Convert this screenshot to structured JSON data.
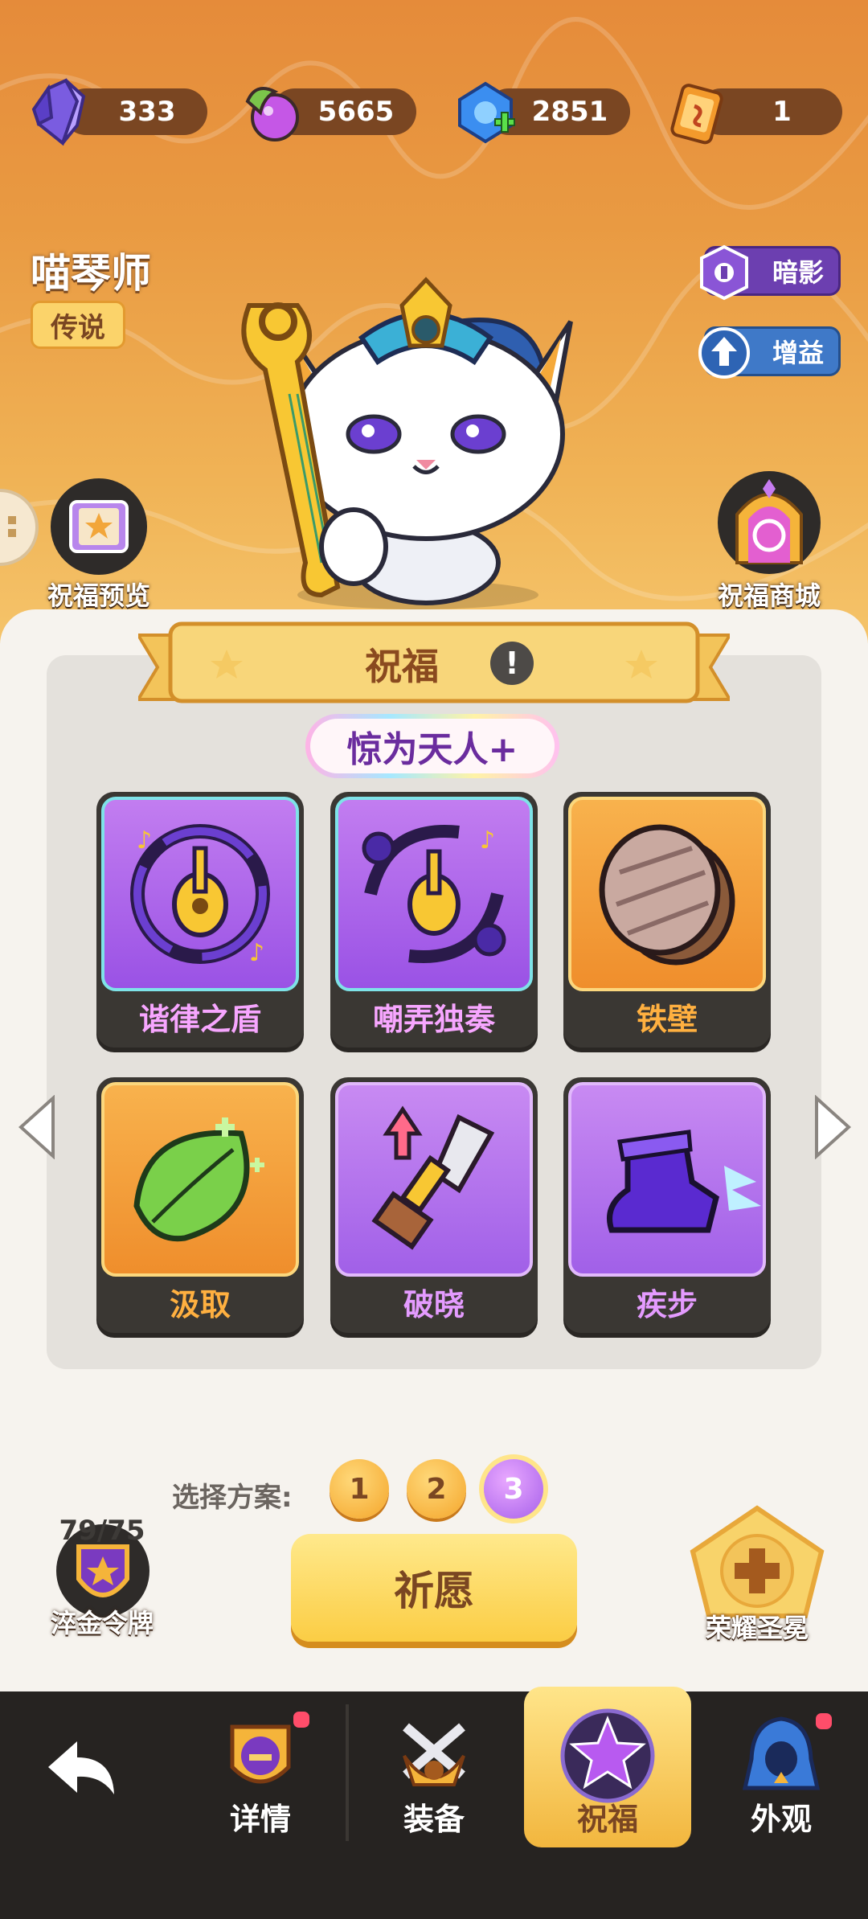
{
  "currency": [
    {
      "icon": "crystal-icon",
      "value": "333"
    },
    {
      "icon": "orb-icon",
      "value": "5665"
    },
    {
      "icon": "gem-plus-icon",
      "value": "2851"
    },
    {
      "icon": "ticket-icon",
      "value": "1"
    }
  ],
  "hero": {
    "name": "喵琴师",
    "rarity": "传说"
  },
  "side_buttons": {
    "shadow": "暗影",
    "buff": "增益"
  },
  "preview_label": "祝福预览",
  "shop_label": "祝福商城",
  "panel": {
    "title": "祝福",
    "info_mark": "!",
    "set_name": "惊为天人+",
    "blessings": [
      {
        "name": "谐律之盾",
        "style": "purple"
      },
      {
        "name": "嘲弄独奏",
        "style": "purple"
      },
      {
        "name": "铁壁",
        "style": "orange"
      },
      {
        "name": "汲取",
        "style": "orange"
      },
      {
        "name": "破晓",
        "style": "violet"
      },
      {
        "name": "疾步",
        "style": "violet"
      }
    ]
  },
  "plan": {
    "label": "选择方案:",
    "options": [
      "1",
      "2",
      "3"
    ],
    "selected": "3"
  },
  "pray_label": "祈愿",
  "token": {
    "count": "79/75",
    "label": "淬金令牌"
  },
  "crown_label": "荣耀圣冕",
  "nav": {
    "back": "back-icon",
    "items": [
      {
        "label": "详情",
        "badge": true
      },
      {
        "label": "装备",
        "badge": false
      },
      {
        "label": "祝福",
        "badge": false,
        "active": true
      },
      {
        "label": "外观",
        "badge": true
      }
    ]
  },
  "colors": {
    "accent": "#f2b63e",
    "dark": "#262321",
    "brown": "#7a4622"
  }
}
